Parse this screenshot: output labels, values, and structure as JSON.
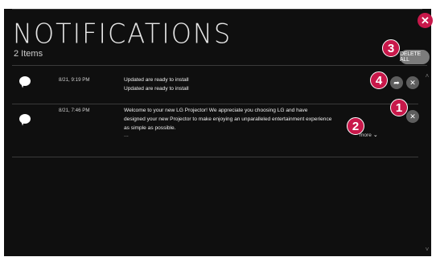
{
  "header": {
    "title": "NOTIFICATIONS",
    "count": "2 Items",
    "delete_all_label": "DELETE ALL"
  },
  "notifications": [
    {
      "time": "8/21, 9:19 PM",
      "lines": [
        "Updated are ready to install",
        "Updated are ready to install"
      ]
    },
    {
      "time": "8/21, 7:46 PM",
      "lines": [
        "Welcome to your new LG Projector! We appreciate you choosing LG and have",
        "designed your new Projector to make enjoying an unparalleled entertainment experience",
        "as simple as possible."
      ],
      "ellipsis": "...",
      "more_label": "more"
    }
  ],
  "badges": [
    "1",
    "2",
    "3",
    "4"
  ],
  "icons": {
    "close": "close-icon",
    "share": "share-icon",
    "delete": "delete-icon",
    "bubble": "chat-bubble-icon",
    "more": "chevron-down-icon"
  },
  "colors": {
    "accent": "#c8184a",
    "background": "#0f0f0f",
    "button": "#5e5e5e"
  }
}
